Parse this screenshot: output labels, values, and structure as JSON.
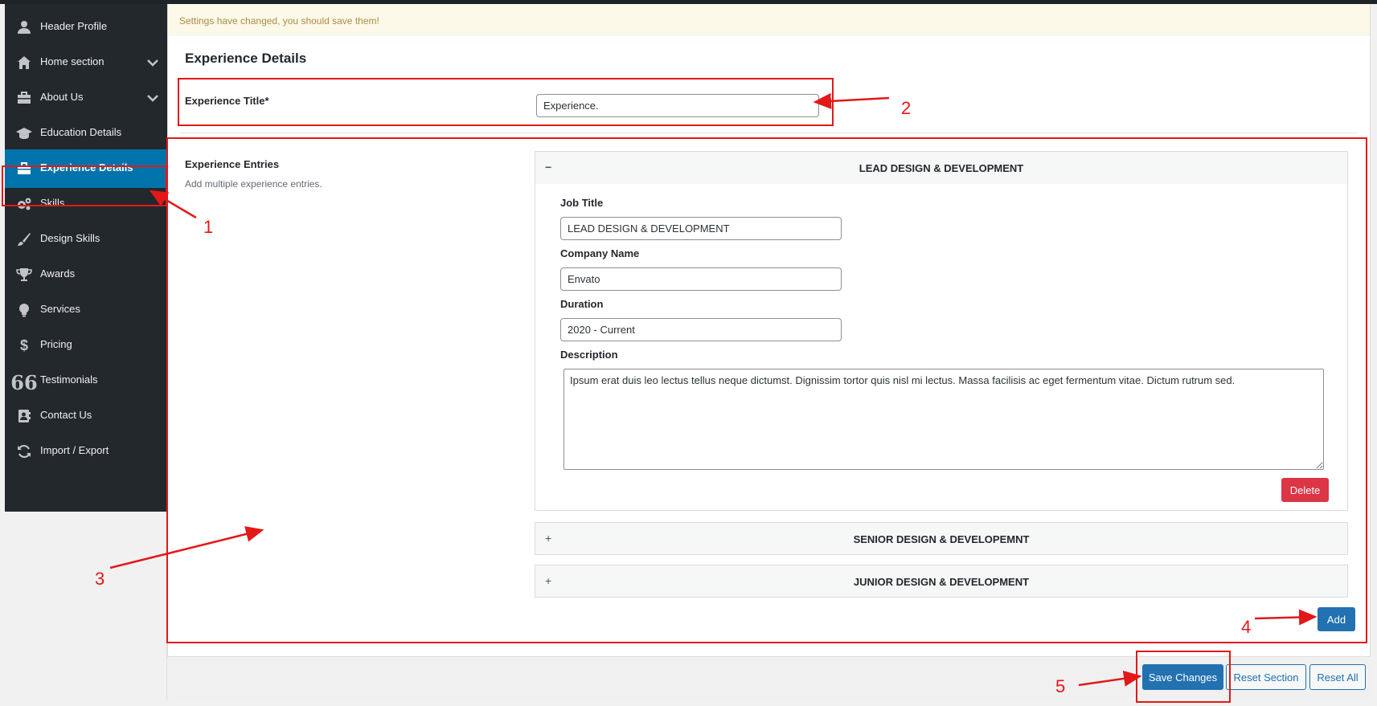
{
  "sidebar": {
    "items": [
      {
        "label": "Header Profile",
        "icon": "user-icon",
        "has_chevron": false
      },
      {
        "label": "Home section",
        "icon": "home-icon",
        "has_chevron": true
      },
      {
        "label": "About Us",
        "icon": "briefcase-icon",
        "has_chevron": true
      },
      {
        "label": "Education Details",
        "icon": "graduation-cap-icon",
        "has_chevron": false
      },
      {
        "label": "Experience Details",
        "icon": "briefcase-icon",
        "has_chevron": false,
        "active": true
      },
      {
        "label": "Skills",
        "icon": "cogs-icon",
        "has_chevron": false
      },
      {
        "label": "Design Skills",
        "icon": "brush-icon",
        "has_chevron": false
      },
      {
        "label": "Awards",
        "icon": "trophy-icon",
        "has_chevron": false
      },
      {
        "label": "Services",
        "icon": "lightbulb-icon",
        "has_chevron": false
      },
      {
        "label": "Pricing",
        "icon": "dollar-icon",
        "has_chevron": false
      },
      {
        "label": "Testimonials",
        "icon": "quote-icon",
        "has_chevron": false
      },
      {
        "label": "Contact Us",
        "icon": "contact-card-icon",
        "has_chevron": false
      },
      {
        "label": "Import / Export",
        "icon": "refresh-icon",
        "has_chevron": false
      }
    ]
  },
  "notice": {
    "text": "Settings have changed, you should save them!"
  },
  "section": {
    "title": "Experience Details",
    "experience_title": {
      "label": "Experience Title*",
      "value": "Experience."
    },
    "entries": {
      "label": "Experience Entries",
      "description": "Add multiple experience entries.",
      "items": [
        {
          "title": "LEAD DESIGN & DEVELOPMENT",
          "expanded": true,
          "job_title_label": "Job Title",
          "job_title": "LEAD DESIGN & DEVELOPMENT",
          "company_label": "Company Name",
          "company": "Envato",
          "duration_label": "Duration",
          "duration": "2020 - Current",
          "description_label": "Description",
          "description": "Ipsum erat duis leo lectus tellus neque dictumst. Dignissim tortor quis nisl mi lectus. Massa facilisis ac eget fermentum vitae. Dictum rutrum sed.",
          "delete_label": "Delete"
        },
        {
          "title": "SENIOR DESIGN & DEVELOPEMNT",
          "expanded": false
        },
        {
          "title": "JUNIOR DESIGN & DEVELOPMENT",
          "expanded": false
        }
      ],
      "add_label": "Add"
    }
  },
  "footer": {
    "save_label": "Save Changes",
    "reset_section_label": "Reset Section",
    "reset_all_label": "Reset All"
  },
  "annotations": {
    "color": "#e31818",
    "numbers": [
      "1",
      "2",
      "3",
      "4",
      "5"
    ]
  },
  "colors": {
    "sidebar_bg": "#23282d",
    "active_bg": "#0073aa",
    "primary_button": "#2271b1",
    "delete_button": "#dc3545",
    "notice_bg": "#fcf9e8"
  }
}
